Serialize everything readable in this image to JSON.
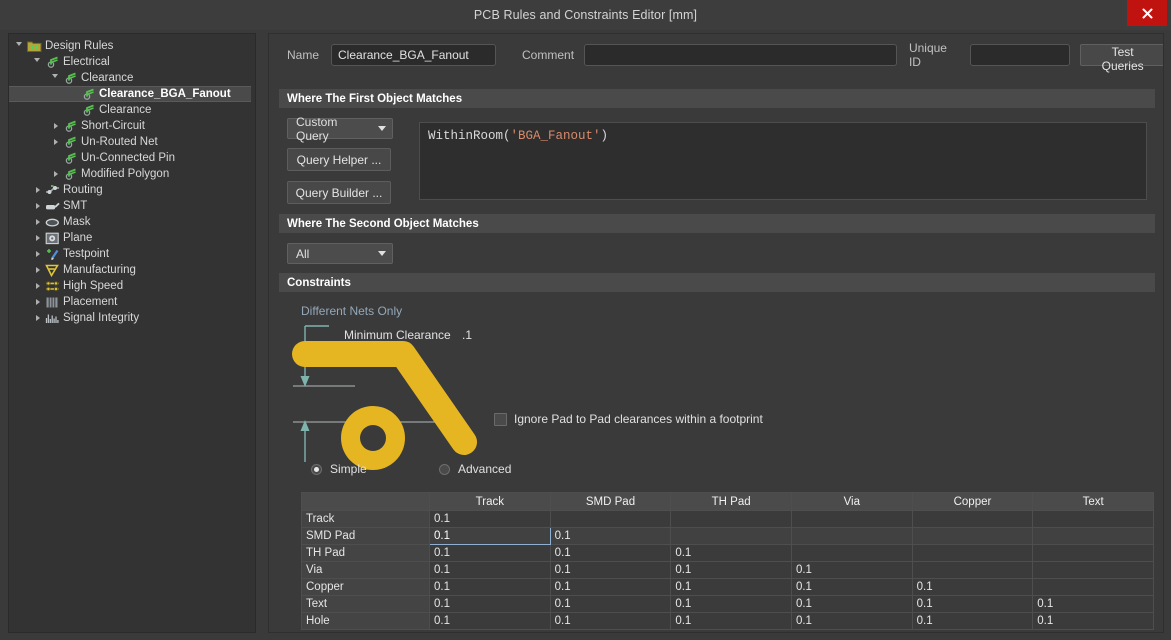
{
  "window": {
    "title": "PCB Rules and Constraints Editor [mm]",
    "close_icon": "close-icon"
  },
  "tree": {
    "items": [
      {
        "label": "Design Rules",
        "indent": 0,
        "arrow": "expanded",
        "icon": "design-rules-folder-icon",
        "selected": false
      },
      {
        "label": "Electrical",
        "indent": 1,
        "arrow": "expanded",
        "icon": "electrical-icon",
        "selected": false
      },
      {
        "label": "Clearance",
        "indent": 2,
        "arrow": "expanded",
        "icon": "clearance-icon",
        "selected": false
      },
      {
        "label": "Clearance_BGA_Fanout",
        "indent": 3,
        "arrow": "none",
        "icon": "clearance-icon",
        "selected": true
      },
      {
        "label": "Clearance",
        "indent": 3,
        "arrow": "none",
        "icon": "clearance-icon",
        "selected": false
      },
      {
        "label": "Short-Circuit",
        "indent": 2,
        "arrow": "collapsed",
        "icon": "short-circuit-icon",
        "selected": false
      },
      {
        "label": "Un-Routed Net",
        "indent": 2,
        "arrow": "collapsed",
        "icon": "un-routed-net-icon",
        "selected": false
      },
      {
        "label": "Un-Connected Pin",
        "indent": 2,
        "arrow": "none",
        "icon": "un-connected-pin-icon",
        "selected": false
      },
      {
        "label": "Modified Polygon",
        "indent": 2,
        "arrow": "collapsed",
        "icon": "modified-polygon-icon",
        "selected": false
      },
      {
        "label": "Routing",
        "indent": 1,
        "arrow": "collapsed",
        "icon": "routing-icon",
        "selected": false
      },
      {
        "label": "SMT",
        "indent": 1,
        "arrow": "collapsed",
        "icon": "smt-icon",
        "selected": false
      },
      {
        "label": "Mask",
        "indent": 1,
        "arrow": "collapsed",
        "icon": "mask-icon",
        "selected": false
      },
      {
        "label": "Plane",
        "indent": 1,
        "arrow": "collapsed",
        "icon": "plane-icon",
        "selected": false
      },
      {
        "label": "Testpoint",
        "indent": 1,
        "arrow": "collapsed",
        "icon": "testpoint-icon",
        "selected": false
      },
      {
        "label": "Manufacturing",
        "indent": 1,
        "arrow": "collapsed",
        "icon": "manufacturing-icon",
        "selected": false
      },
      {
        "label": "High Speed",
        "indent": 1,
        "arrow": "collapsed",
        "icon": "high-speed-icon",
        "selected": false
      },
      {
        "label": "Placement",
        "indent": 1,
        "arrow": "collapsed",
        "icon": "placement-icon",
        "selected": false
      },
      {
        "label": "Signal Integrity",
        "indent": 1,
        "arrow": "collapsed",
        "icon": "signal-integrity-icon",
        "selected": false
      }
    ]
  },
  "form": {
    "name_label": "Name",
    "name_value": "Clearance_BGA_Fanout",
    "comment_label": "Comment",
    "comment_value": "",
    "comment_placeholder": "",
    "unique_id_label": "Unique ID",
    "unique_id_value": "",
    "test_queries_label": "Test Queries"
  },
  "first_object": {
    "header": "Where The First Object Matches",
    "scope_selected": "Custom Query",
    "query_helper_label": "Query Helper ...",
    "query_builder_label": "Query Builder ...",
    "query_fn": "WithinRoom(",
    "query_str": "'BGA_Fanout'",
    "query_close": ")"
  },
  "second_object": {
    "header": "Where The Second Object Matches",
    "scope_selected": "All"
  },
  "constraints": {
    "header": "Constraints",
    "different_nets_only": "Different Nets Only",
    "minimum_clearance_label": "Minimum Clearance",
    "minimum_clearance_value": ".1",
    "ignore_pad_label": "Ignore Pad to Pad clearances within a footprint",
    "ignore_pad_checked": false,
    "mode_simple": "Simple",
    "mode_advanced": "Advanced",
    "mode_selected": "Simple"
  },
  "matrix": {
    "columns": [
      "Track",
      "SMD Pad",
      "TH Pad",
      "Via",
      "Copper",
      "Text"
    ],
    "rows": [
      {
        "label": "Track",
        "values": [
          "0.1",
          "",
          "",
          "",
          "",
          ""
        ]
      },
      {
        "label": "SMD Pad",
        "values": [
          "0.1",
          "0.1",
          "",
          "",
          "",
          ""
        ]
      },
      {
        "label": "TH Pad",
        "values": [
          "0.1",
          "0.1",
          "0.1",
          "",
          "",
          ""
        ]
      },
      {
        "label": "Via",
        "values": [
          "0.1",
          "0.1",
          "0.1",
          "0.1",
          "",
          ""
        ]
      },
      {
        "label": "Copper",
        "values": [
          "0.1",
          "0.1",
          "0.1",
          "0.1",
          "0.1",
          ""
        ]
      },
      {
        "label": "Text",
        "values": [
          "0.1",
          "0.1",
          "0.1",
          "0.1",
          "0.1",
          "0.1"
        ]
      },
      {
        "label": "Hole",
        "values": [
          "0.1",
          "0.1",
          "0.1",
          "0.1",
          "0.1",
          "0.1"
        ]
      }
    ],
    "selected_cell": {
      "row": 1,
      "col": 0
    }
  },
  "colors": {
    "accent_track": "#e5b622",
    "selection": "#6d90b4",
    "close_red": "#c0120f",
    "teal": "#6fb0ab",
    "string_literal": "#d98a6a"
  }
}
